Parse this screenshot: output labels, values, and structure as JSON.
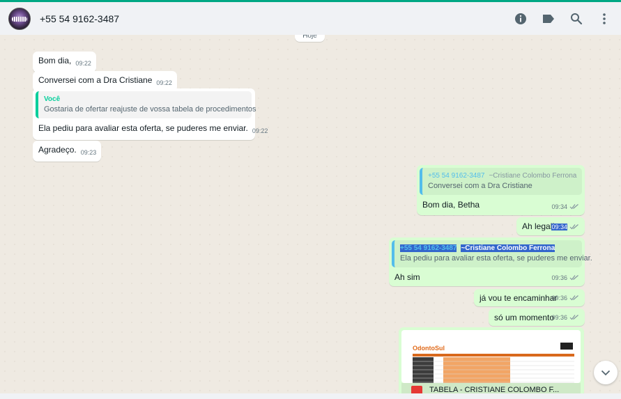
{
  "header": {
    "contact_name": "+55 54 9162-3487",
    "icons": [
      "info-icon",
      "label-icon",
      "search-icon",
      "menu-dots-icon"
    ]
  },
  "date_pill": "Hoje",
  "incoming": [
    {
      "text": "Bom dia,",
      "time": "09:22"
    },
    {
      "text": "Conversei com a Dra Cristiane",
      "time": "09:22"
    },
    {
      "quote_author": "Você",
      "quote_text": "Gostaria de ofertar reajuste de vossa tabela de procedimentos",
      "text": "Ela pediu para avaliar esta oferta, se puderes me enviar.",
      "time": "09:22"
    },
    {
      "text": "Agradeço.",
      "time": "09:23"
    }
  ],
  "outgoing": [
    {
      "quote_author": "+55 54 9162-3487",
      "quote_sub": "~Cristiane Colombo Ferrona",
      "quote_text": "Conversei com a Dra Cristiane",
      "text": "Bom dia, Betha",
      "time": "09:34"
    },
    {
      "text": "Ah legal!",
      "time": "09:34"
    },
    {
      "quote_author": "+55 54 9162-3487",
      "quote_sub": "~Cristiane Colombo Ferrona",
      "quote_text": "Ela pediu para avaliar esta oferta, se puderes me enviar.",
      "text": "Ah sim",
      "time": "09:36"
    },
    {
      "text": "já vou te encaminhar",
      "time": "09:36"
    },
    {
      "text": "só um momento",
      "time": "09:36"
    }
  ],
  "document": {
    "title": "TABELA - CRISTIANE COLOMBO F...",
    "brand": "OdontoSul"
  },
  "colors": {
    "accent": "#00a884",
    "outgoing_bubble": "#d9fdd3",
    "incoming_bubble": "#ffffff",
    "read_ticks": "#8696a0",
    "selection": "#3366cc"
  }
}
